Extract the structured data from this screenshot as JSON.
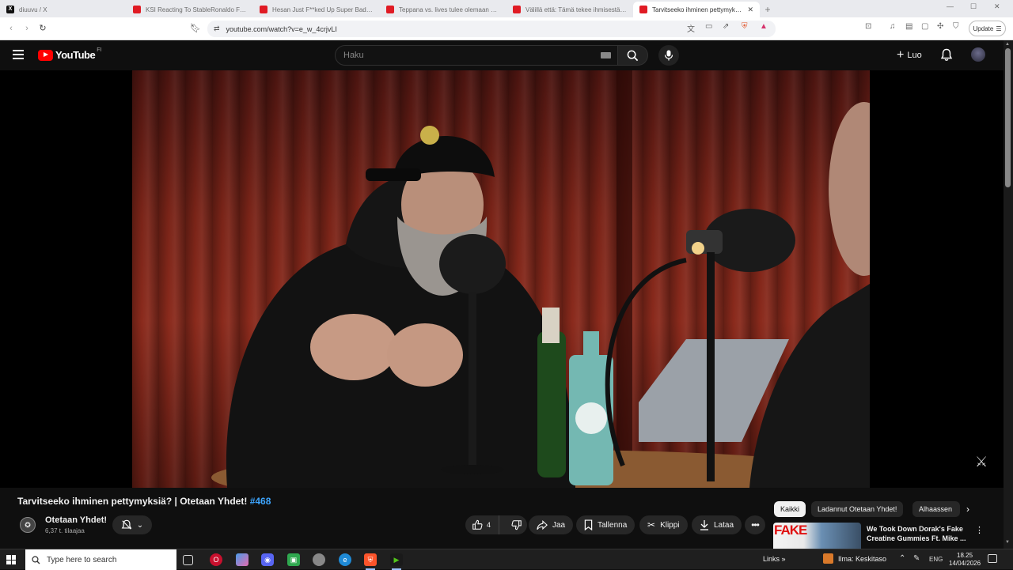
{
  "browser": {
    "tabs": [
      {
        "title": "diuuvu / X",
        "icon": "x-logo-icon"
      },
      {
        "title": "KSI Reacting To StableRonaldo For 9...",
        "icon": "youtube-icon"
      },
      {
        "title": "Hesan Just F**ked Up Super Bad... - Y...",
        "icon": "youtube-icon"
      },
      {
        "title": "Teppana vs. lives tulee olemaan eeppi...",
        "icon": "youtube-icon"
      },
      {
        "title": "Välillä että: Tämä tekee ihmisestä pahi...",
        "icon": "youtube-icon"
      },
      {
        "title": "Tarvitseeko ihminen pettymyksiä?",
        "icon": "youtube-icon",
        "active": true
      }
    ],
    "new_tab": "+",
    "url": "youtube.com/watch?v=e_w_4crjvLI",
    "update_label": "Update"
  },
  "youtube": {
    "logo": "YouTube",
    "region": "FI",
    "search_placeholder": "Haku",
    "create_label": "Luo",
    "video": {
      "title": "Tarvitseeko ihminen pettymyksiä? | Otetaan Yhdet!",
      "hashtag": "#468",
      "channel": "Otetaan Yhdet!",
      "subscribers": "6,37 t. tilaajaa",
      "likes": "4",
      "actions": {
        "share": "Jaa",
        "save": "Tallenna",
        "clip": "Klippi",
        "download": "Lataa"
      }
    },
    "chips": [
      "Kaikki",
      "Ladannut Otetaan Yhdet!",
      "Alhaassen"
    ],
    "recommended": {
      "thumb_text": "FAKE",
      "title": "We Took Down Dorak's Fake Creatine Gummies Ft. Mike ..."
    }
  },
  "taskbar": {
    "search_placeholder": "Type here to search",
    "links": "Links",
    "weather": "Ilma: Keskitaso",
    "lang": "ENG",
    "time": "18.25",
    "date": "14/04/2026"
  }
}
